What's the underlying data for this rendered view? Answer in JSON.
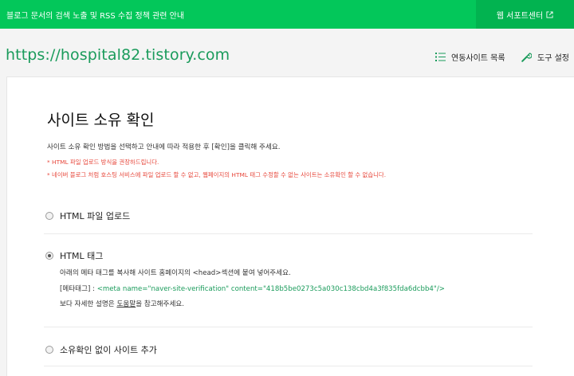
{
  "topbar": {
    "notice": "블로그 문서의 검색 노출 및 RSS 수집 정책 관련 안내",
    "webmaster_label": "웹 서포트센터"
  },
  "site": {
    "url": "https://hospital82.tistory.com"
  },
  "tools": {
    "linked_sites": "연동사이트 목록",
    "tool_settings": "도구 설정"
  },
  "content": {
    "title": "사이트 소유 확인",
    "description": "사이트 소유 확인 방법을 선택하고 안내에 따라 적용한 후 [확인]을 클릭해 주세요.",
    "note1": "* HTML 파일 업로드 방식을 권장하드립니다.",
    "note2": "* 네이버 블로그 처럼 호스팅 서비스에 파일 업로드 할 수 없고, 웹페이지의 HTML 태그 수정할 수 없는 사이트는 소유확인 할 수 없습니다.",
    "options": [
      {
        "label": "HTML 파일 업로드",
        "checked": false
      },
      {
        "label": "HTML 태그",
        "checked": true
      },
      {
        "label": "소유확인 없이 사이트 추가",
        "checked": false
      }
    ],
    "html_tag": {
      "instruction": "아래의 메타 태그를 복사해 사이트 홈페이지의 <head>섹션에 붙여 넣어주세요.",
      "meta_prefix": "[메타태그] : ",
      "meta_code": "<meta name=\"naver-site-verification\" content=\"418b5be0273c5a030c138cbd4a3f835fda6dcbb4\"/>",
      "help_before": "보다 자세한 설명은 ",
      "help_link": "도움말",
      "help_after": "을 참고해주세요."
    }
  },
  "colors": {
    "brand_green": "#03c75a",
    "url_green": "#1a9b5b",
    "note_red": "#e7483c"
  },
  "icons": {
    "external": "external-link-icon",
    "list": "list-icon",
    "wrench": "wrench-icon"
  }
}
